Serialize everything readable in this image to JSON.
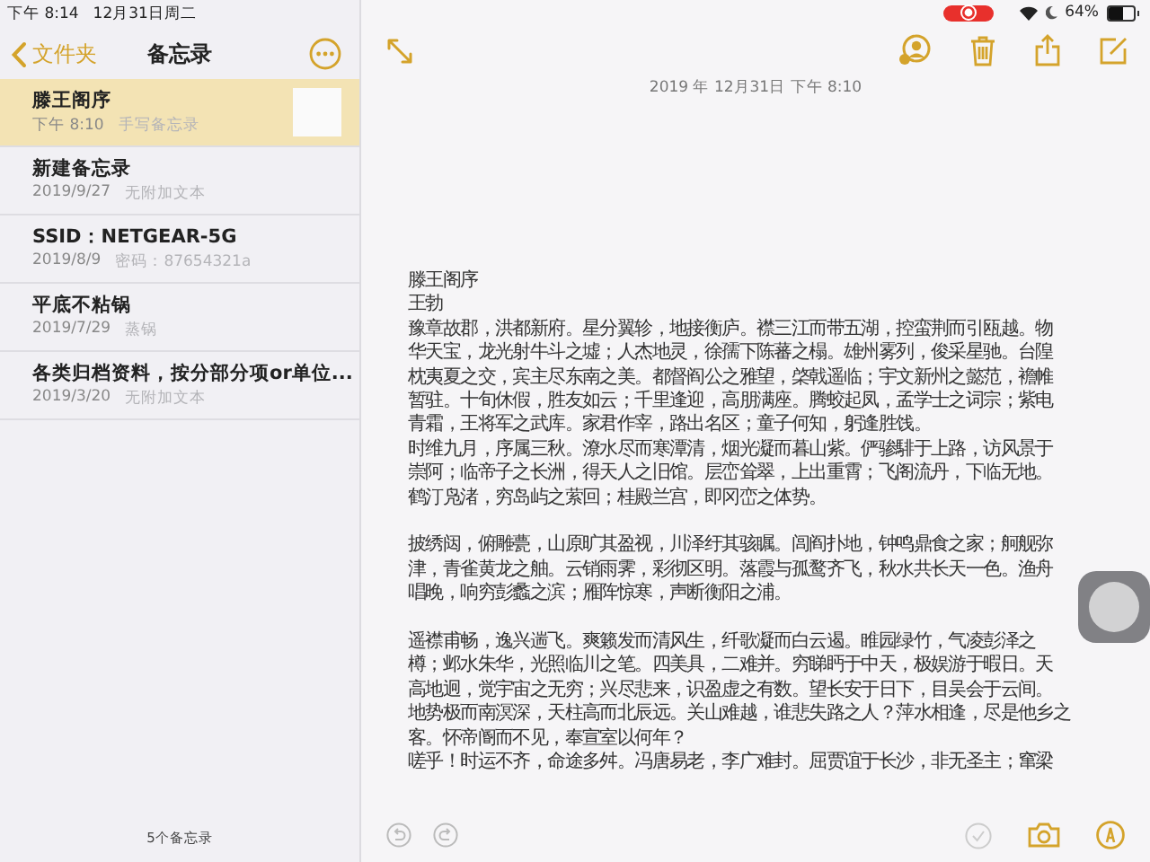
{
  "status_bar": {
    "time": "下午 8:14",
    "date": "12月31日周二",
    "recording": true,
    "battery_text": "64%",
    "battery": {
      "level": 0.64
    }
  },
  "sidebar": {
    "back_label": "文件夹",
    "title": "备忘录",
    "notes": [
      {
        "title": "滕王阁序",
        "date": "下午 8:10",
        "preview": "手写备忘录",
        "selected": true,
        "has_thumbnail": true
      },
      {
        "title": "新建备忘录",
        "date": "2019/9/27",
        "preview": "无附加文本",
        "selected": false,
        "has_thumbnail": false
      },
      {
        "title": "SSID：NETGEAR-5G",
        "date": "2019/8/9",
        "preview": "密码：87654321a",
        "selected": false,
        "has_thumbnail": false
      },
      {
        "title": "平底不粘锅",
        "date": "2019/7/29",
        "preview": "蒸锅",
        "selected": false,
        "has_thumbnail": false
      },
      {
        "title": "各类归档资料，按分部分项or单位...",
        "date": "2019/3/20",
        "preview": "无附加文本",
        "selected": false,
        "has_thumbnail": false
      }
    ],
    "count": "5个备忘录"
  },
  "note": {
    "timestamp": "2019 年 12月31日 下午 8:10",
    "blocks": [
      [
        "滕王阁序",
        "王勃",
        "豫章故郡，洪都新府。星分翼轸，地接衡庐。襟三江而带五湖，控蛮荆而引瓯越。物",
        "华天宝，龙光射牛斗之墟；人杰地灵，徐孺下陈蕃之榻。雄州雾列，俊采星驰。台隍",
        "枕夷夏之交，宾主尽东南之美。都督阎公之雅望，棨戟遥临；宇文新州之懿范，襜帷",
        "暂驻。十旬休假，胜友如云；千里逢迎，高朋满座。腾蛟起凤，孟学士之词宗；紫电",
        "青霜，王将军之武库。家君作宰，路出名区；童子何知，躬逢胜饯。",
        "时维九月，序属三秋。潦水尽而寒潭清，烟光凝而暮山紫。俨骖騑于上路，访风景于",
        "崇阿；临帝子之长洲，得天人之旧馆。层峦耸翠，上出重霄；飞阁流丹，下临无地。",
        "鹤汀凫渚，穷岛屿之萦回；桂殿兰宫，即冈峦之体势。"
      ],
      [
        "披绣闼，俯雕甍，山原旷其盈视，川泽纡其骇瞩。闾阎扑地，钟鸣鼎食之家；舸舰弥",
        "津，青雀黄龙之舳。云销雨霁，彩彻区明。落霞与孤鹜齐飞，秋水共长天一色。渔舟",
        "唱晚，响穷彭蠡之滨；雁阵惊寒，声断衡阳之浦。"
      ],
      [
        "遥襟甫畅，逸兴遄飞。爽籁发而清风生，纤歌凝而白云遏。睢园绿竹，气凌彭泽之",
        "樽；邺水朱华，光照临川之笔。四美具，二难并。穷睇眄于中天，极娱游于暇日。天",
        "高地迥，觉宇宙之无穷；兴尽悲来，识盈虚之有数。望长安于日下，目吴会于云间。",
        "地势极而南溟深，天柱高而北辰远。关山难越，谁悲失路之人？萍水相逢，尽是他乡之",
        "客。怀帝阍而不见，奉宣室以何年？",
        "嗟乎！时运不齐，命途多舛。冯唐易老，李广难封。屈贾谊于长沙，非无圣主；窜梁"
      ]
    ]
  }
}
